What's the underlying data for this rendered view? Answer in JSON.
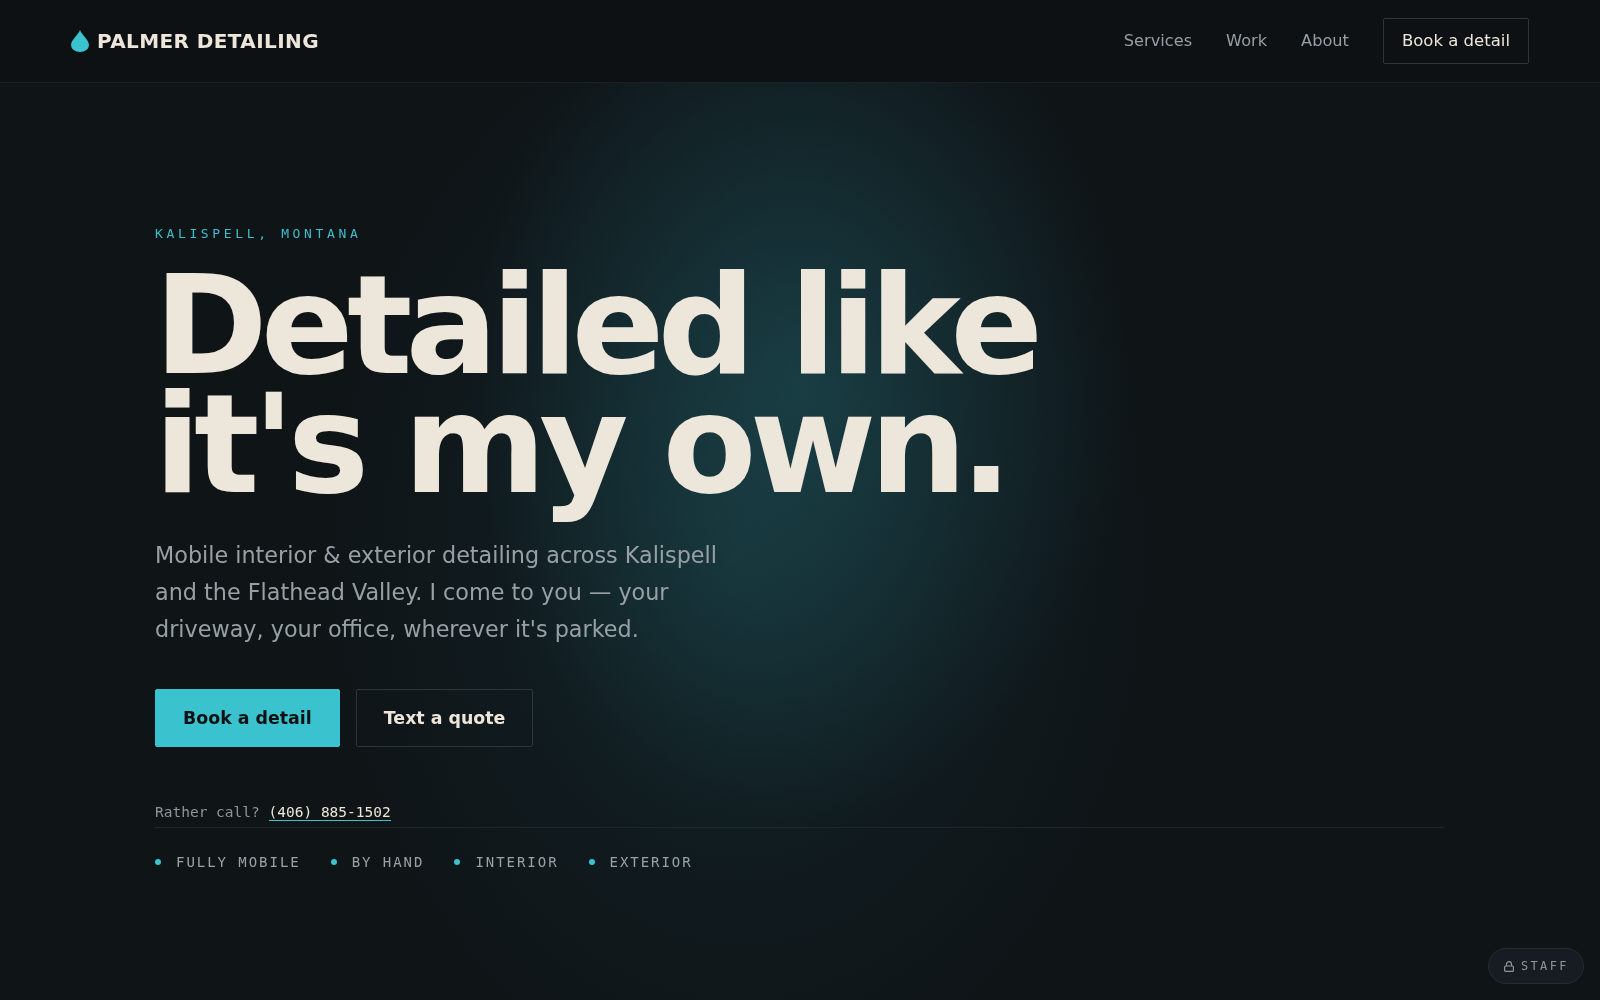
{
  "brand": {
    "name": "PALMER DETAILING"
  },
  "nav": {
    "links": [
      "Services",
      "Work",
      "About"
    ],
    "cta": "Book a detail"
  },
  "hero": {
    "kicker": "KALISPELL, MONTANA",
    "headline": "Detailed like it's my own.",
    "lede": "Mobile interior & exterior detailing across Kalispell and the Flathead Valley. I come to you — your driveway, your office, wherever it's parked.",
    "buttons": [
      {
        "label": "Book a detail",
        "kind": "primary"
      },
      {
        "label": "Text a quote",
        "kind": "outline"
      }
    ],
    "call": {
      "prompt": "Rather call?",
      "phone": "(406) 885-1502"
    },
    "features": [
      "FULLY MOBILE",
      "BY HAND",
      "INTERIOR",
      "EXTERIOR"
    ]
  },
  "staff_button": {
    "label": "STAFF"
  }
}
